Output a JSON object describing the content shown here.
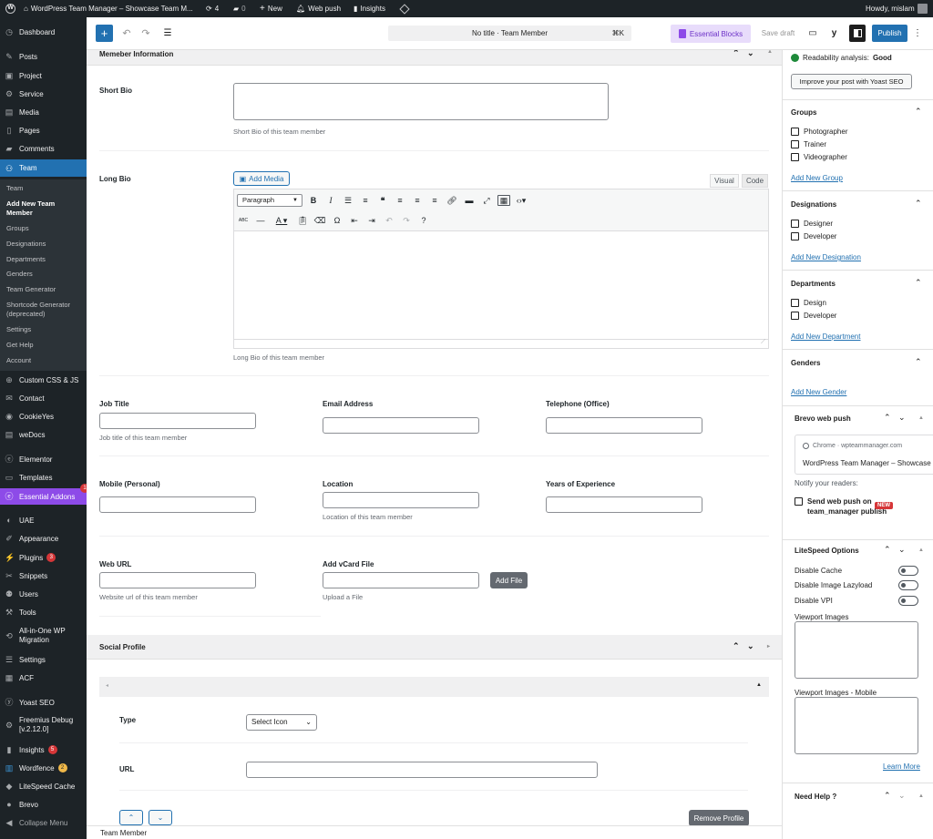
{
  "adminbar": {
    "site_title": "WordPress Team Manager – Showcase Team M...",
    "updates_count": "4",
    "comments_count": "0",
    "new_label": "New",
    "webpush_label": "Web push",
    "insights_label": "Insights",
    "howdy": "Howdy, mislam"
  },
  "sidebar": {
    "dashboard": "Dashboard",
    "posts": "Posts",
    "project": "Project",
    "service": "Service",
    "media": "Media",
    "pages": "Pages",
    "comments": "Comments",
    "team": "Team",
    "sub": [
      "Team",
      "Add New Team Member",
      "Groups",
      "Designations",
      "Departments",
      "Genders",
      "Team Generator",
      "Shortcode Generator (deprecated)",
      "Settings",
      "Get Help",
      "Account"
    ],
    "custom_css": "Custom CSS & JS",
    "contact": "Contact",
    "cookieyes": "CookieYes",
    "wedocs": "weDocs",
    "elementor": "Elementor",
    "templates": "Templates",
    "essential_addons": "Essential Addons",
    "essential_addons_badge": "1",
    "uae": "UAE",
    "appearance": "Appearance",
    "plugins": "Plugins",
    "plugins_badge": "3",
    "snippets": "Snippets",
    "users": "Users",
    "tools": "Tools",
    "aio_migration": "All-in-One WP Migration",
    "settings": "Settings",
    "acf": "ACF",
    "yoast": "Yoast SEO",
    "freemius": "Freemius Debug [v.2.12.0]",
    "insights": "Insights",
    "insights_badge": "5",
    "wordfence": "Wordfence",
    "wordfence_badge": "2",
    "litespeed": "LiteSpeed Cache",
    "brevo": "Brevo",
    "collapse": "Collapse Menu"
  },
  "toolbar": {
    "doc_title": "No title · Team Member",
    "shortcut": "⌘K",
    "essential_blocks": "Essential Blocks",
    "save_draft": "Save draft",
    "publish": "Publish"
  },
  "member_info": {
    "title": "Memeber Information",
    "short_bio_label": "Short Bio",
    "short_bio_desc": "Short Bio of this team member",
    "long_bio_label": "Long Bio",
    "add_media": "Add Media",
    "tab_visual": "Visual",
    "tab_code": "Code",
    "format_select": "Paragraph",
    "long_bio_desc": "Long Bio of this team member",
    "job_title_label": "Job Title",
    "job_title_desc": "Job title of this team member",
    "email_label": "Email Address",
    "telephone_label": "Telephone (Office)",
    "mobile_label": "Mobile (Personal)",
    "location_label": "Location",
    "location_desc": "Location of this team member",
    "experience_label": "Years of Experience",
    "web_url_label": "Web URL",
    "web_url_desc": "Website url of this team member",
    "vcard_label": "Add vCard File",
    "add_file": "Add File",
    "upload_desc": "Upload a File"
  },
  "social": {
    "title": "Social Profile",
    "type_label": "Type",
    "select_value": "Select Icon",
    "url_label": "URL",
    "remove_btn": "Remove Profile"
  },
  "settings": {
    "readability": "Readability analysis:",
    "readability_value": "Good",
    "improve_btn": "Improve your post with Yoast SEO",
    "groups_title": "Groups",
    "groups": [
      "Photographer",
      "Trainer",
      "Videographer"
    ],
    "add_group": "Add New Group",
    "designations_title": "Designations",
    "designations": [
      "Designer",
      "Developer"
    ],
    "add_designation": "Add New Designation",
    "departments_title": "Departments",
    "departments": [
      "Design",
      "Developer"
    ],
    "add_department": "Add New Department",
    "genders_title": "Genders",
    "add_gender": "Add New Gender",
    "brevo_title": "Brevo web push",
    "brevo_source": "Chrome · wpteammanager.com",
    "brevo_preview": "WordPress Team Manager – Showcase",
    "notify": "Notify your readers:",
    "send_push": "Send web push on team_manager publish",
    "new_badge": "NEW",
    "litespeed_title": "LiteSpeed Options",
    "disable_cache": "Disable Cache",
    "disable_lazy": "Disable Image Lazyload",
    "disable_vpi": "Disable VPI",
    "viewport_images": "Viewport Images",
    "viewport_mobile": "Viewport Images - Mobile",
    "learn_more": "Learn More",
    "need_help": "Need Help ?"
  },
  "footer": {
    "breadcrumb": "Team Member"
  }
}
